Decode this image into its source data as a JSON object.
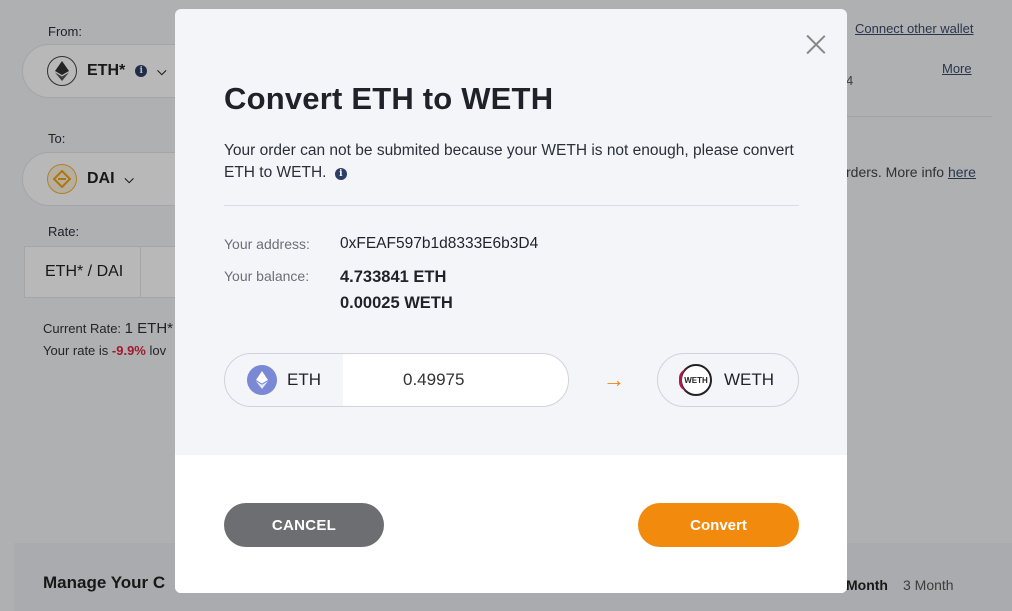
{
  "background": {
    "from_label": "From:",
    "from_token": "ETH*",
    "to_label": "To:",
    "to_token": "DAI",
    "rate_label": "Rate:",
    "rate_pair": "ETH* / DAI",
    "current_rate_prefix": "Current Rate:",
    "current_rate_value": "1 ETH*",
    "rate_note_prefix": "Your rate is",
    "rate_note_pct": "-9.9%",
    "rate_note_suffix": "lov",
    "connect_other_wallet": "Connect other wallet",
    "more_link": "More",
    "partial_value": "4",
    "orders_text": "rders. More info",
    "here_link": "here",
    "manage_title": "Manage Your C",
    "timeframe_month": "Month",
    "timeframe_3month": "3 Month"
  },
  "modal": {
    "title": "Convert ETH to WETH",
    "description": "Your order can not be submited because your WETH is not enough, please convert ETH to WETH.",
    "address_label": "Your address:",
    "address_value": "0xFEAF597b1d8333E6b3D4",
    "balance_label": "Your balance:",
    "balance_eth": "4.733841 ETH",
    "balance_weth": "0.00025 WETH",
    "from_token": "ETH",
    "amount": "0.49975",
    "to_token": "WETH",
    "weth_icon_text": "WETH",
    "cancel_label": "CANCEL",
    "convert_label": "Convert"
  },
  "colors": {
    "accent": "#f28a0e",
    "cancel": "#6d6e71",
    "negative": "#e0243f"
  }
}
